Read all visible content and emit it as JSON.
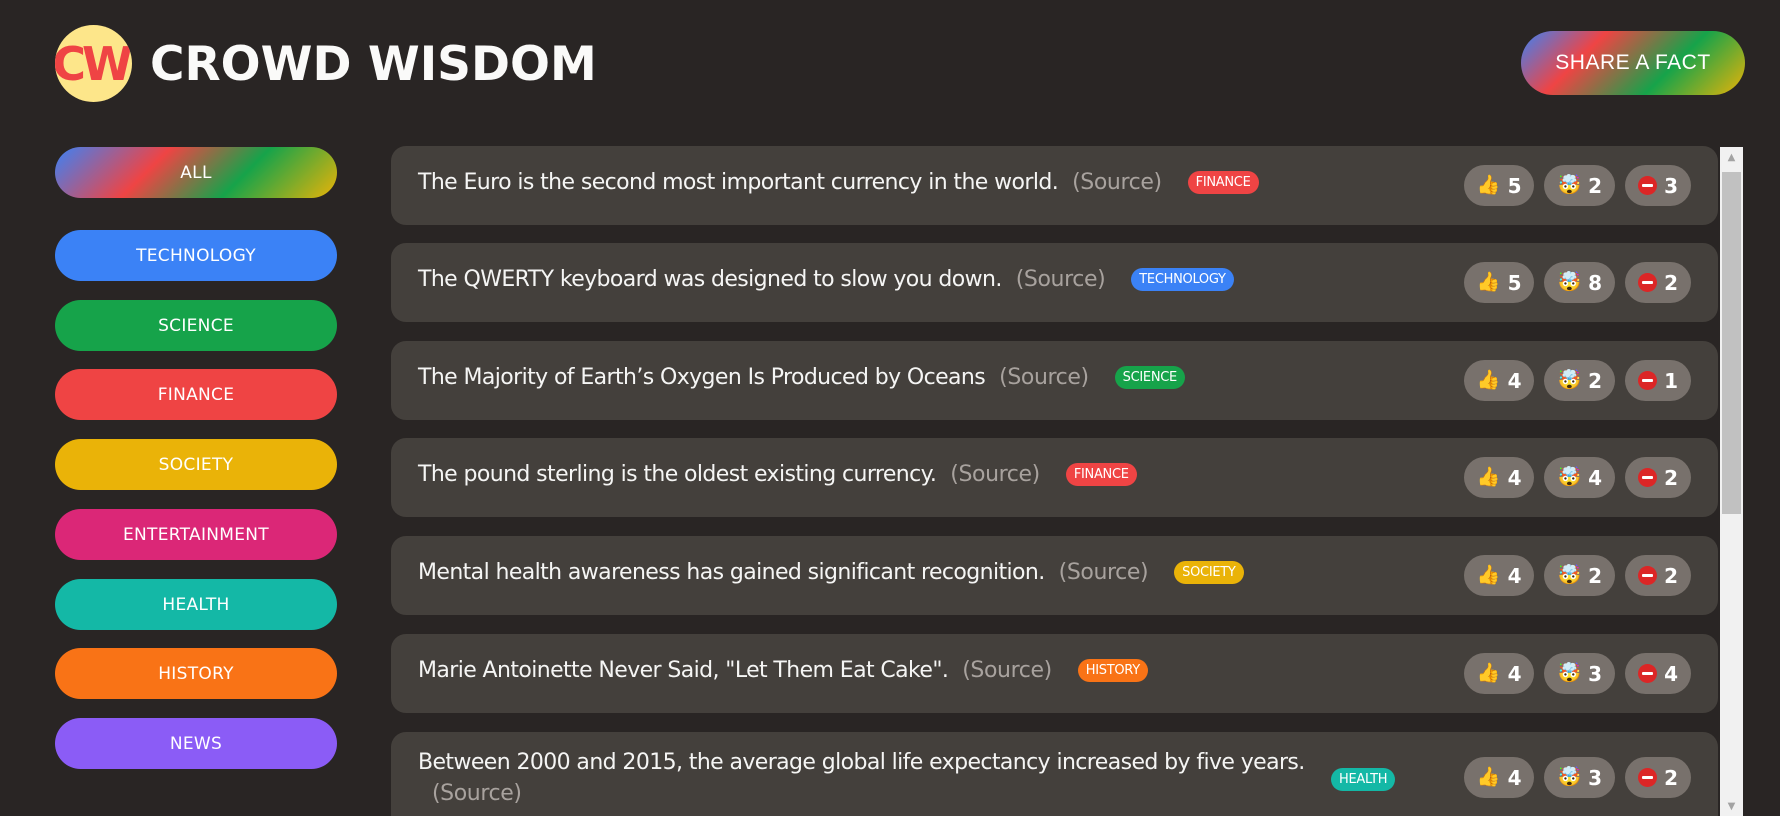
{
  "header": {
    "logo_text": "CW",
    "title": "CROWD WISDOM",
    "share_label": "SHARE A FACT"
  },
  "sidebar": {
    "all_label": "ALL",
    "categories": [
      {
        "label": "TECHNOLOGY",
        "color": "#3b82f6"
      },
      {
        "label": "SCIENCE",
        "color": "#16a34a"
      },
      {
        "label": "FINANCE",
        "color": "#ef4444"
      },
      {
        "label": "SOCIETY",
        "color": "#eab308"
      },
      {
        "label": "ENTERTAINMENT",
        "color": "#db2777"
      },
      {
        "label": "HEALTH",
        "color": "#14b8a6"
      },
      {
        "label": "HISTORY",
        "color": "#f97316"
      },
      {
        "label": "NEWS",
        "color": "#8b5cf6"
      }
    ]
  },
  "facts": [
    {
      "text": "The Euro is the second most important currency in the world.",
      "source": "(Source)",
      "category": "FINANCE",
      "color": "#ef4444",
      "interesting": "5",
      "mindblowing": "2",
      "false": "3"
    },
    {
      "text": "The QWERTY keyboard was designed to slow you down.",
      "source": "(Source)",
      "category": "TECHNOLOGY",
      "color": "#3b82f6",
      "interesting": "5",
      "mindblowing": "8",
      "false": "2"
    },
    {
      "text": "The Majority of Earth’s Oxygen Is Produced by Oceans",
      "source": "(Source)",
      "category": "SCIENCE",
      "color": "#16a34a",
      "interesting": "4",
      "mindblowing": "2",
      "false": "1"
    },
    {
      "text": "The pound sterling is the oldest existing currency.",
      "source": "(Source)",
      "category": "FINANCE",
      "color": "#ef4444",
      "interesting": "4",
      "mindblowing": "4",
      "false": "2"
    },
    {
      "text": "Mental health awareness has gained significant recognition.",
      "source": "(Source)",
      "category": "SOCIETY",
      "color": "#eab308",
      "interesting": "4",
      "mindblowing": "2",
      "false": "2"
    },
    {
      "text": "Marie Antoinette Never Said, \"Let Them Eat Cake\".",
      "source": "(Source)",
      "category": "HISTORY",
      "color": "#f97316",
      "interesting": "4",
      "mindblowing": "3",
      "false": "4"
    },
    {
      "text": "Between 2000 and 2015, the average global life expectancy increased by five years.",
      "source": "(Source)",
      "category": "HEALTH",
      "color": "#14b8a6",
      "interesting": "4",
      "mindblowing": "3",
      "false": "2"
    }
  ],
  "icons": {
    "interesting": "thumbs-up-icon",
    "mindblowing": "mind-blown-icon",
    "false": "no-entry-icon"
  }
}
